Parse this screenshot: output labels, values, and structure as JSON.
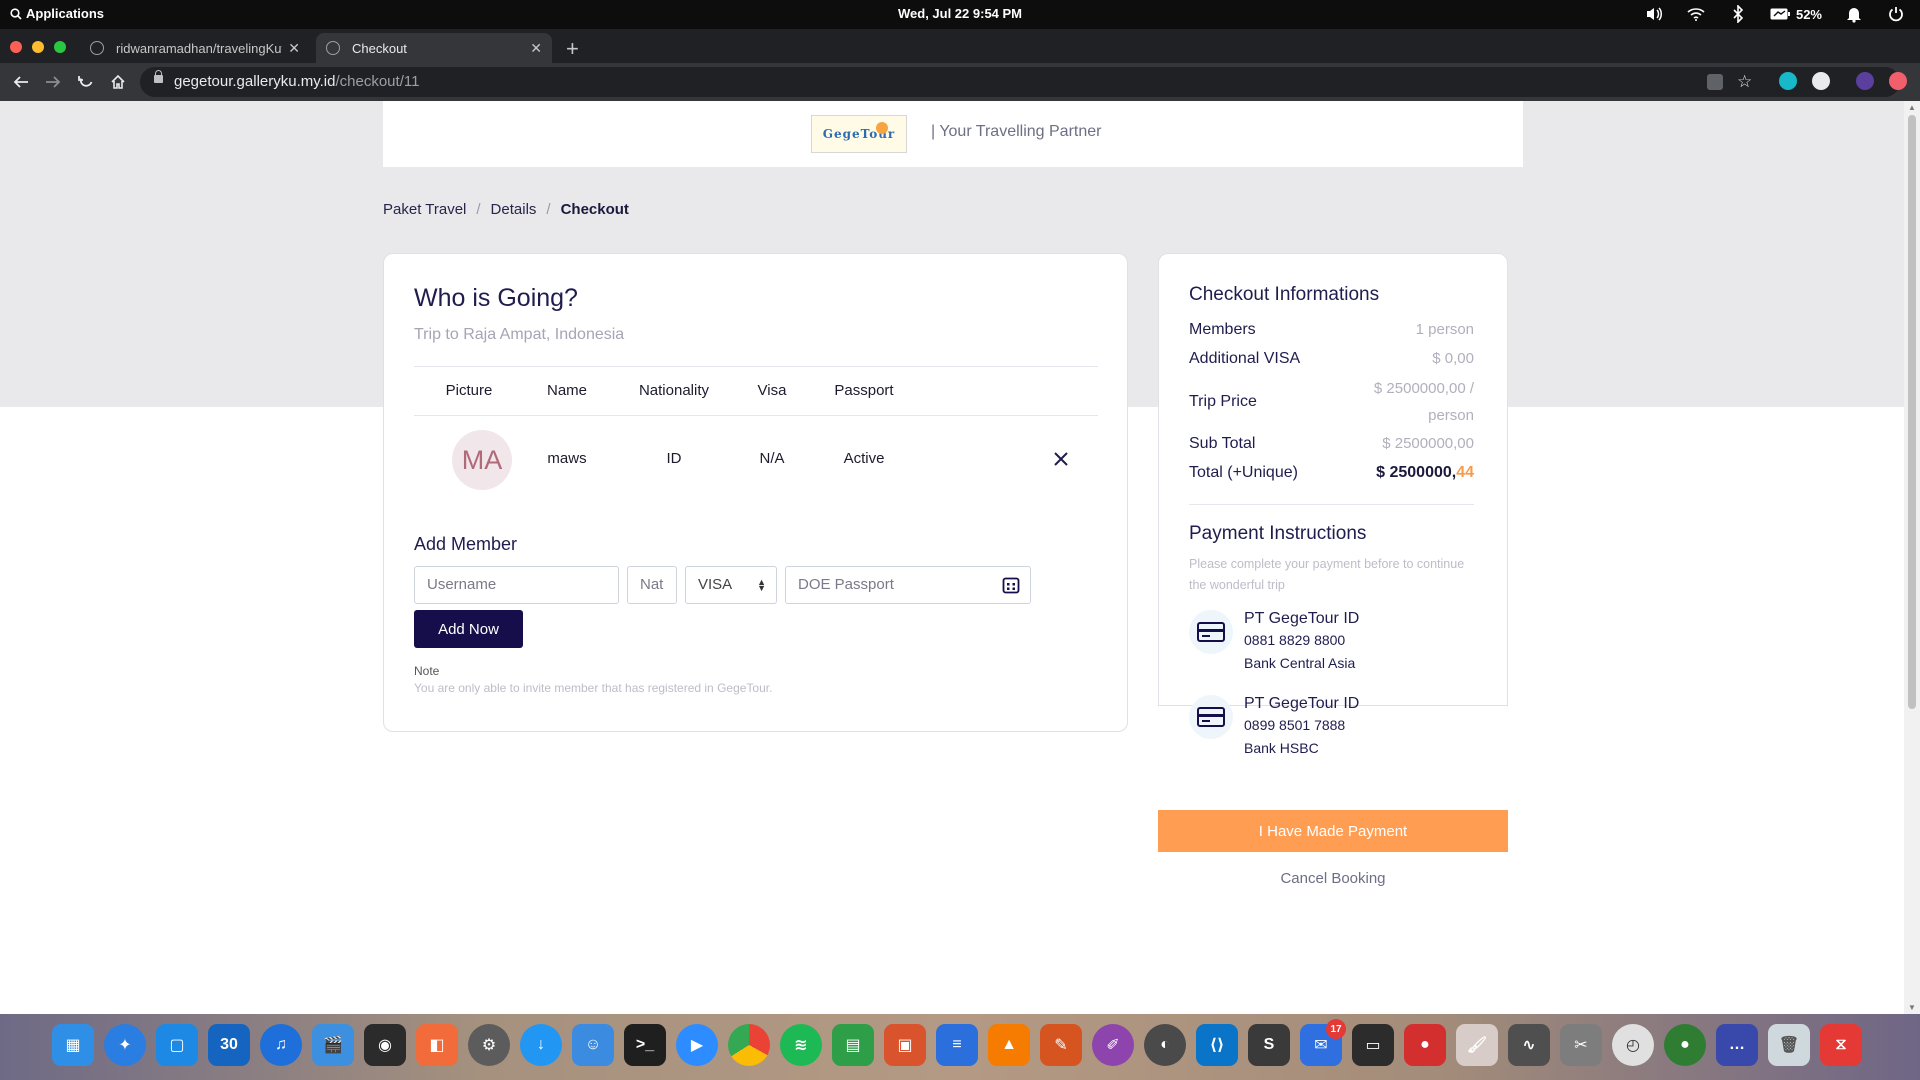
{
  "system": {
    "apps_label": "Applications",
    "clock": "Wed, Jul 22   9:54 PM",
    "battery": "52%"
  },
  "browser": {
    "tabs": [
      {
        "title": "ridwanramadhan/travelingKuy"
      },
      {
        "title": "Checkout"
      }
    ],
    "url_host": "gegetour.galleryku.my.id",
    "url_path": "/checkout/11"
  },
  "header": {
    "logo_text": "GegeTour",
    "tagline": "|  Your Travelling Partner"
  },
  "breadcrumb": {
    "items": [
      "Paket Travel",
      "Details",
      "Checkout"
    ],
    "separator": "/"
  },
  "who": {
    "title": "Who is Going?",
    "subtitle": "Trip to Raja Ampat, Indonesia",
    "columns": [
      "Picture",
      "Name",
      "Nationality",
      "Visa",
      "Passport"
    ],
    "members": [
      {
        "initials": "MA",
        "name": "maws",
        "nationality": "ID",
        "visa": "N/A",
        "passport": "Active"
      }
    ]
  },
  "add_member": {
    "title": "Add Member",
    "username_placeholder": "Username",
    "nat_placeholder": "Nat",
    "visa_value": "VISA",
    "doe_placeholder": "DOE Passport",
    "button": "Add Now",
    "note_label": "Note",
    "note_text": "You are only able to invite member that has registered in GegeTour."
  },
  "checkout": {
    "title": "Checkout Informations",
    "members_label": "Members",
    "members_value": "1 person",
    "visa_label": "Additional VISA",
    "visa_value": "$ 0,00",
    "trip_label": "Trip Price",
    "trip_value_1": "$ 2500000,00 /",
    "trip_value_2": "person",
    "subtotal_label": "Sub Total",
    "subtotal_value": "$ 2500000,00",
    "total_label": "Total (+Unique)",
    "total_value": "$ 2500000,",
    "total_unique": "44"
  },
  "payment": {
    "title": "Payment Instructions",
    "text": "Please complete your payment before to continue the wonderful trip",
    "banks": [
      {
        "name": "PT GegeTour ID",
        "account": "0881 8829 8800",
        "bank": "Bank Central Asia"
      },
      {
        "name": "PT GegeTour ID",
        "account": "0899 8501 7888",
        "bank": "Bank HSBC"
      }
    ],
    "paid_button": "I Have Made Payment",
    "cancel": "Cancel Booking"
  },
  "dock": {
    "calendar_day": "30",
    "mail_badge": "17"
  },
  "colors": {
    "primary": "#160e4b",
    "accent": "#ff9e53",
    "page_gray": "#e9e9ec"
  }
}
